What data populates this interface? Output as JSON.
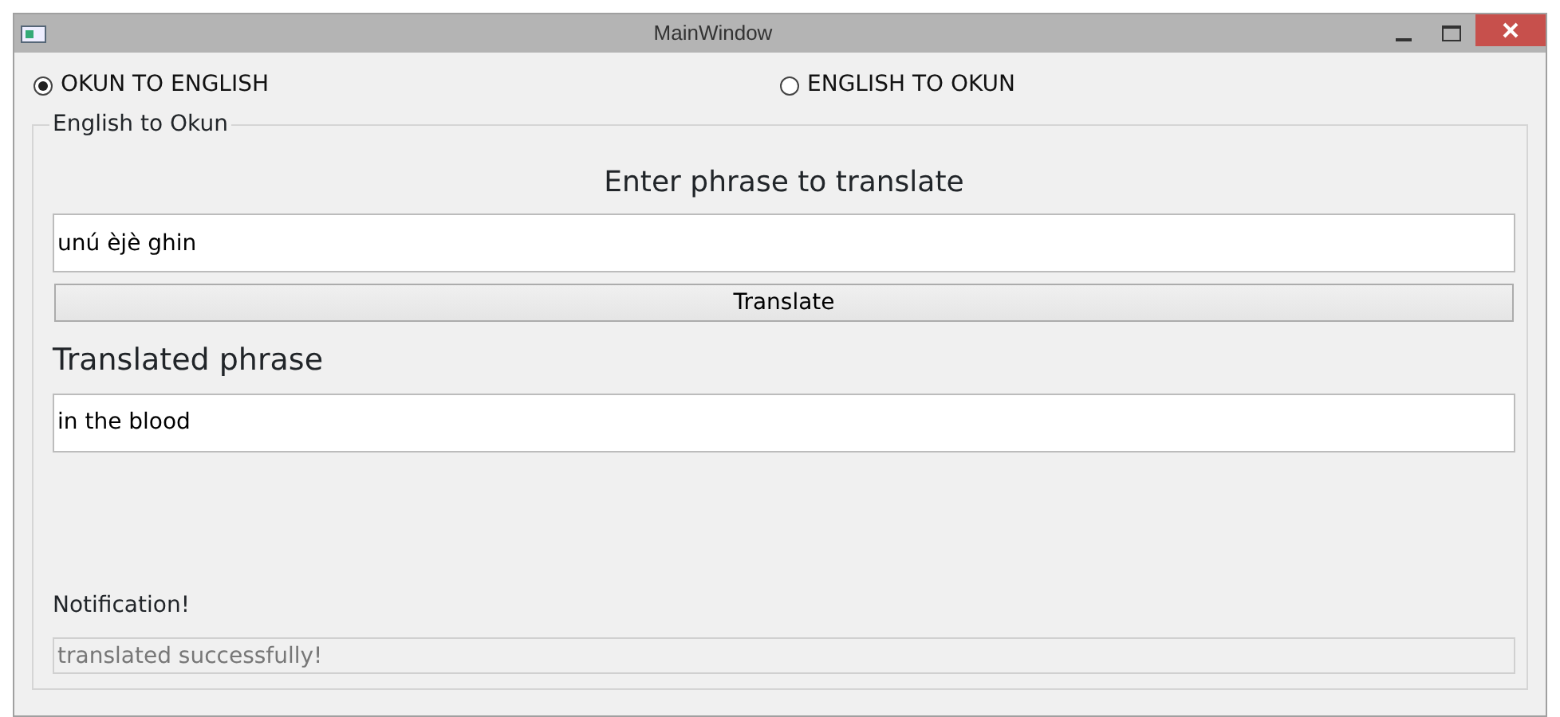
{
  "window": {
    "title": "MainWindow"
  },
  "modes": [
    {
      "label": "OKUN TO ENGLISH",
      "selected": true
    },
    {
      "label": "ENGLISH TO OKUN",
      "selected": false
    }
  ],
  "group": {
    "title": "English to Okun",
    "prompt": "Enter phrase to translate",
    "input": {
      "value": "unú èjè ghin"
    },
    "button": "Translate",
    "result_label": "Translated phrase",
    "result": {
      "value": "in the blood"
    },
    "notification_label": "Notification!",
    "notification": {
      "value": "translated successfully!",
      "disabled": true
    }
  }
}
